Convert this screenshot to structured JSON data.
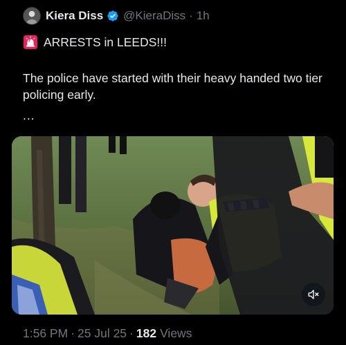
{
  "post": {
    "author": {
      "display_name": "Kiera Diss",
      "handle": "@KieraDiss",
      "verified": true,
      "verified_color": "#1d9bf0",
      "time_ago": "1h"
    },
    "text": {
      "headline_emoji": "rotating-light-icon",
      "headline": "ARRESTS in LEEDS!!!",
      "paragraph": "The police have started with their heavy handed two tier policing early.",
      "continuation": "..."
    },
    "media": {
      "type": "video",
      "mute_icon": "speaker-muted-icon"
    },
    "footer": {
      "time": "1:56 PM",
      "date": "25 Jul 25",
      "views_count": "182",
      "views_label": "Views",
      "separator": "·"
    }
  },
  "colors": {
    "background": "#000000",
    "primary_text": "#e7e9ea",
    "secondary_text": "#71767b",
    "verified_blue": "#1d9bf0",
    "hi_vis_yellow": "#d8e83a"
  }
}
